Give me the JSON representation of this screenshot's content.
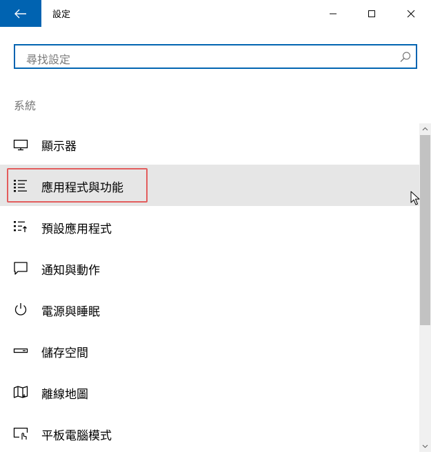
{
  "window": {
    "title": "設定"
  },
  "search": {
    "placeholder": "尋找設定"
  },
  "section": {
    "label": "系統"
  },
  "nav_items": [
    {
      "label": "顯示器",
      "icon": "monitor-icon"
    },
    {
      "label": "應用程式與功能",
      "icon": "apps-list-icon",
      "selected": true
    },
    {
      "label": "預設應用程式",
      "icon": "default-apps-icon"
    },
    {
      "label": "通知與動作",
      "icon": "notification-icon"
    },
    {
      "label": "電源與睡眠",
      "icon": "power-icon"
    },
    {
      "label": "儲存空間",
      "icon": "storage-icon"
    },
    {
      "label": "離線地圖",
      "icon": "map-icon"
    },
    {
      "label": "平板電腦模式",
      "icon": "tablet-mode-icon"
    }
  ],
  "colors": {
    "accent": "#0063b1",
    "selected_bg": "#e6e6e6",
    "highlight_border": "#e35c5c"
  }
}
